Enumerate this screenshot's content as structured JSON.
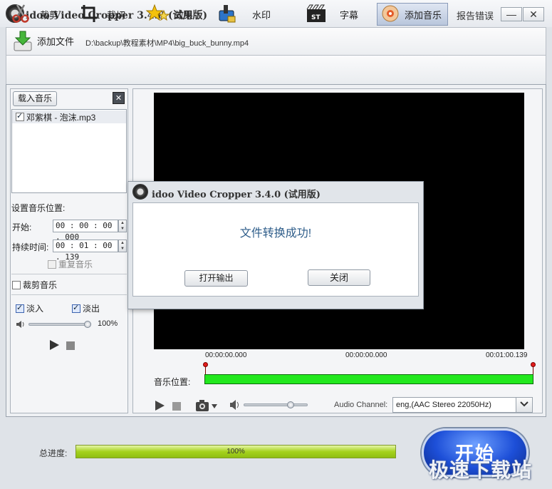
{
  "app": {
    "title": "idoo Video Cropper 3.4.0 (试用版)",
    "report": "报告错误"
  },
  "window": {
    "minimize": "—",
    "close": "✕"
  },
  "add_file": {
    "label": "添加文件",
    "path": "D:\\backup\\教程素材\\MP4\\big_buck_bunny.mp4"
  },
  "tools": [
    {
      "label": "裁剪",
      "icon": "scissors-icon"
    },
    {
      "label": "裁切",
      "icon": "crop-icon"
    },
    {
      "label": "效果",
      "icon": "stars-icon"
    },
    {
      "label": "水印",
      "icon": "watermark-icon"
    },
    {
      "label": "字幕",
      "icon": "subtitle-icon"
    },
    {
      "label": "添加音乐",
      "icon": "music-disc-icon",
      "active": true
    }
  ],
  "music": {
    "load_button": "载入音乐",
    "close": "✕",
    "files": [
      {
        "name": "邓紫棋 - 泡沫.mp3",
        "checked": true
      }
    ],
    "position_heading": "设置音乐位置:",
    "start_label": "开始:",
    "start_value": "00 : 00 : 00 . 000",
    "duration_label": "持续时间:",
    "duration_value": "00 : 01 : 00 . 139",
    "repeat_label": "重复音乐",
    "trim_label": "裁剪音乐",
    "fade_in": "淡入",
    "fade_out": "淡出",
    "volume_percent": "100%"
  },
  "player": {
    "time_start": "00:00:00.000",
    "time_mid": "00:00:00.000",
    "time_end": "00:01:00.139",
    "music_position_label": "音乐位置:",
    "audio_channel_label": "Audio Channel:",
    "audio_channel_value": "eng,(AAC Stereo 22050Hz)"
  },
  "dialog": {
    "title": "idoo Video Cropper 3.4.0 (试用版)",
    "message": "文件转换成功!",
    "open_output": "打开输出",
    "close": "关闭"
  },
  "footer": {
    "progress_label": "总进度:",
    "progress_value": 1.0,
    "progress_text": "100%",
    "start": "开始"
  },
  "watermark": "极速下载站",
  "colors": {
    "accent": "#2a57d8",
    "progress": "#a5d21e",
    "track": "#22e81e",
    "dialog_text": "#2e5d8a"
  }
}
